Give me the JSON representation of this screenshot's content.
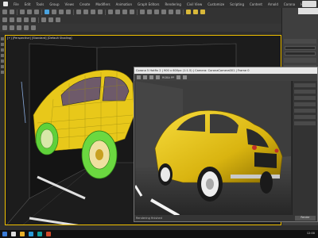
{
  "menubar": {
    "items": [
      "File",
      "Edit",
      "Tools",
      "Group",
      "Views",
      "Create",
      "Modifiers",
      "Animation",
      "Graph Editors",
      "Rendering",
      "Civil View",
      "Customize",
      "Scripting",
      "Content",
      "Arnold",
      "Corona",
      "Help"
    ]
  },
  "viewport": {
    "label": "[+] [Perspective] [Standard] [Default Shading]"
  },
  "render_window": {
    "title": "Corona 5 Hotfix 2 | 900 x 600px (1:1.5) | Camera: CoronaCamera001 | Frame 0",
    "toolbar_label": "RGBA PP",
    "status": "Rendering finished",
    "button_label": "Render"
  },
  "taskbar": {
    "clock": "12:00"
  },
  "colors": {
    "car_body": "#e8c81a",
    "viewport_border": "#f0c000",
    "wire_green": "#5fd13a",
    "accent": "#4aa3df"
  }
}
